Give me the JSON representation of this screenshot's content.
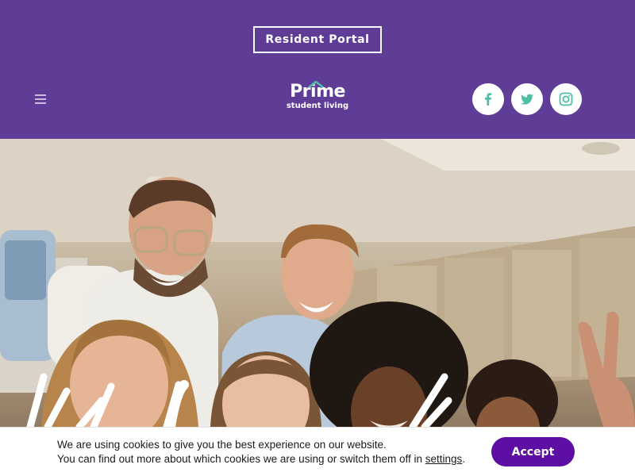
{
  "header": {
    "portal_label": "Resident Portal",
    "logo": {
      "word": "Prime",
      "tagline": "student living"
    },
    "social": [
      {
        "name": "facebook-icon",
        "glyph": "f"
      },
      {
        "name": "twitter-icon"
      },
      {
        "name": "instagram-icon"
      }
    ]
  },
  "colors": {
    "header_bg": "#5f3d97",
    "social_icon": "#4cbfa6",
    "accept_bg": "#5d0fa3"
  },
  "cookie": {
    "line1": "We are using cookies to give you the best experience on our website.",
    "line2_prefix": "You can find out more about which cookies we are using or switch them off in",
    "settings_link": "settings",
    "line2_suffix": ".",
    "accept_label": "Accept"
  }
}
